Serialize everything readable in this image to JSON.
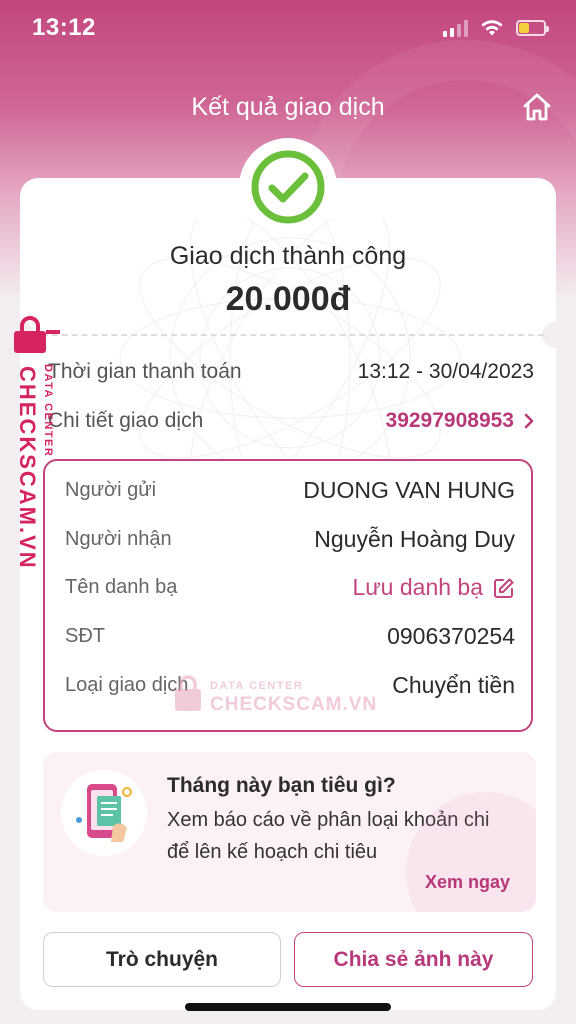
{
  "status_bar": {
    "time": "13:12"
  },
  "header": {
    "title": "Kết quả giao dịch"
  },
  "result": {
    "title": "Giao dịch thành công",
    "amount": "20.000đ"
  },
  "info": {
    "payment_time_label": "Thời gian thanh toán",
    "payment_time_value": "13:12 - 30/04/2023",
    "detail_label": "Chi tiết giao dịch",
    "detail_value": "39297908953"
  },
  "details": {
    "sender_label": "Người gửi",
    "sender_value": "DUONG VAN HUNG",
    "receiver_label": "Người nhận",
    "receiver_value": "Nguyễn Hoàng Duy",
    "contact_label": "Tên danh bạ",
    "contact_value": "Lưu danh bạ",
    "phone_label": "SĐT",
    "phone_value": "0906370254",
    "type_label": "Loại giao dịch",
    "type_value": "Chuyển tiền"
  },
  "promo": {
    "title": "Tháng này bạn tiêu gì?",
    "desc": "Xem báo cáo về phân loại khoản chi để lên kế hoạch chi tiêu",
    "link": "Xem ngay"
  },
  "buttons": {
    "chat": "Trò chuyện",
    "share": "Chia sẻ ảnh này"
  },
  "watermark": {
    "brand": "CHECKSCAM.VN",
    "sub": "DATA CENTER"
  },
  "colors": {
    "accent": "#c2457d",
    "success": "#6cbf3a",
    "watermark": "#d5245f"
  }
}
